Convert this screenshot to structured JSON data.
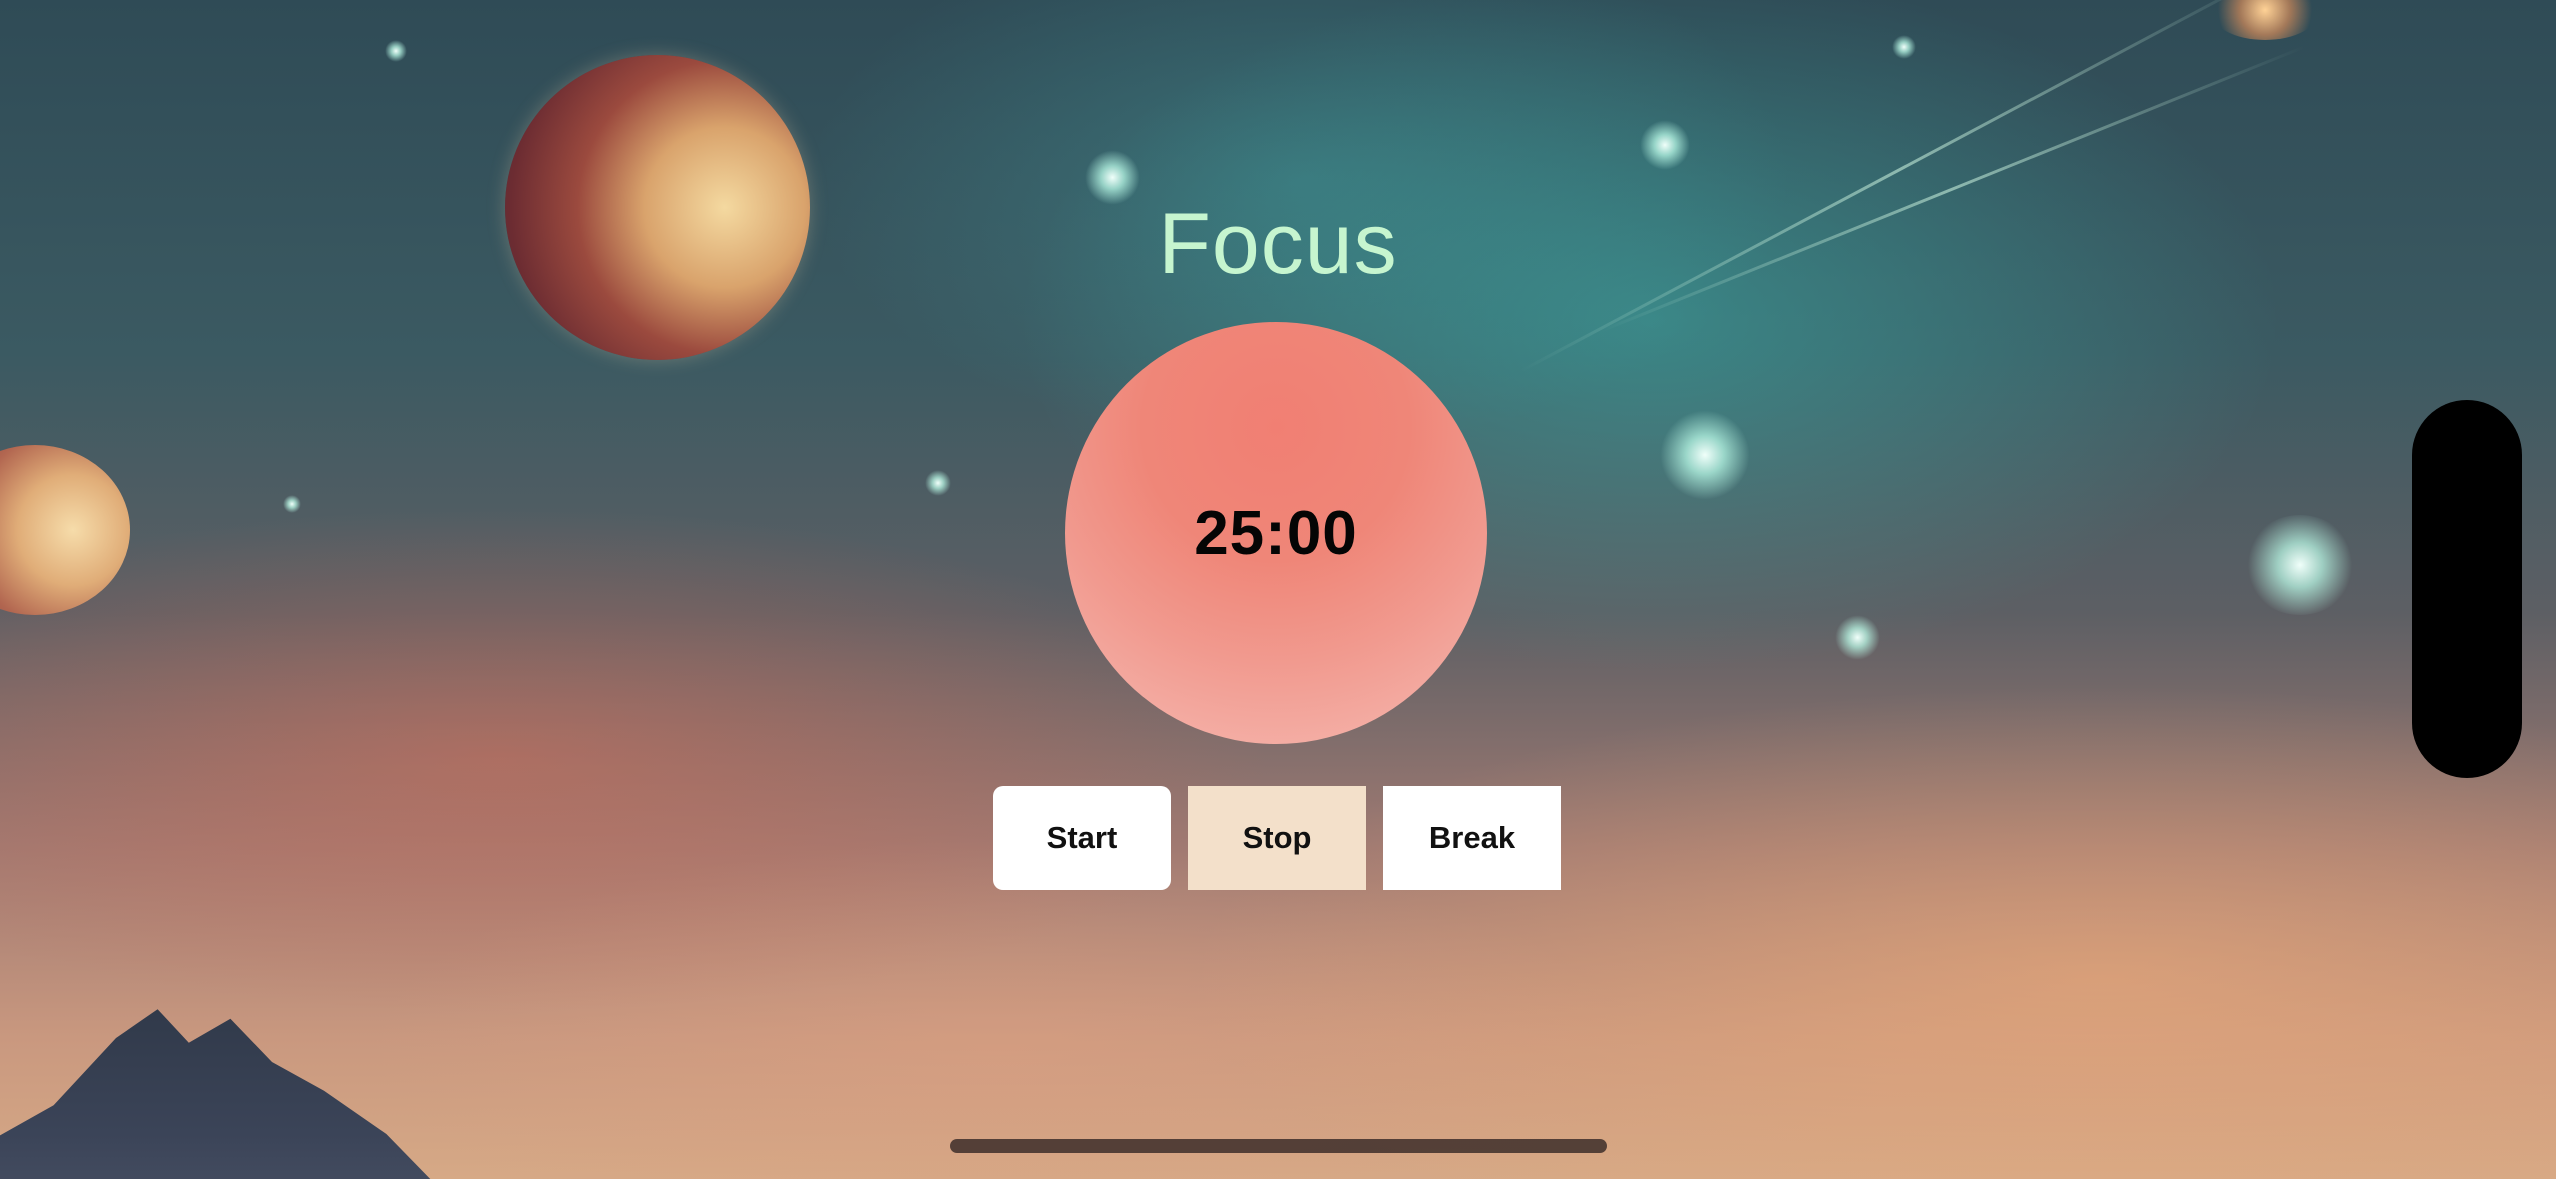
{
  "app": {
    "title": "Focus"
  },
  "timer": {
    "display": "25:00"
  },
  "controls": {
    "start_label": "Start",
    "stop_label": "Stop",
    "break_label": "Break"
  },
  "colors": {
    "title_color": "#c6f5cf",
    "timer_circle": "#f17f73",
    "stop_button": "#f3e0ca",
    "button_default": "#ffffff"
  }
}
